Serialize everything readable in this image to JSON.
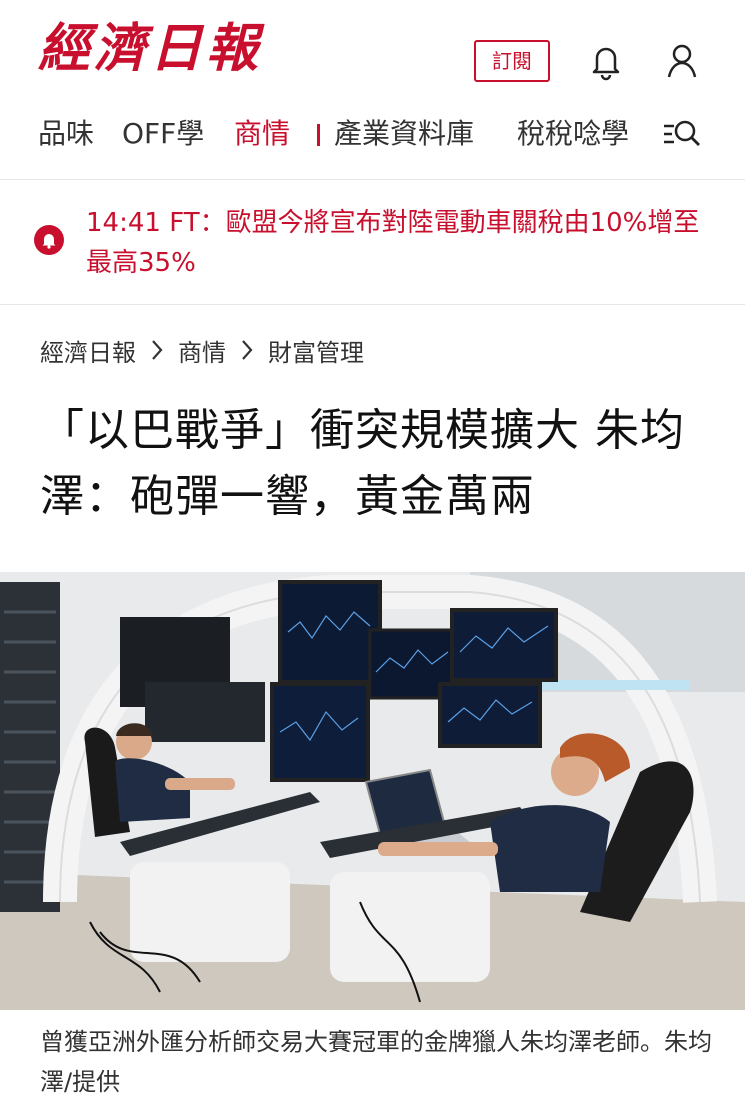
{
  "header": {
    "logo": "經濟日報",
    "subscribe_label": "訂閱",
    "icons": {
      "bell": "bell-icon",
      "user": "user-icon",
      "search": "search-icon"
    },
    "accent_color": "#c8102e"
  },
  "nav": {
    "items": [
      {
        "label": "品味",
        "active": false
      },
      {
        "label": "OFF學",
        "active": false
      },
      {
        "label": "商情",
        "active": true
      },
      {
        "label": "產業資料庫",
        "active": false
      },
      {
        "label": "稅稅唸學",
        "active": false
      }
    ]
  },
  "breaking": {
    "text": "14:41 FT：歐盟今將宣布對陸電動車關稅由10%增至最高35%",
    "icon": "alert-bell-icon"
  },
  "breadcrumb": [
    "經濟日報",
    "商情",
    "財富管理"
  ],
  "article": {
    "title": "「以巴戰爭」衝突規模擴大 朱均澤：砲彈一響，黃金萬兩",
    "caption": "曾獲亞洲外匯分析師交易大賽冠軍的金牌獵人朱均澤老師。朱均澤/提供"
  }
}
